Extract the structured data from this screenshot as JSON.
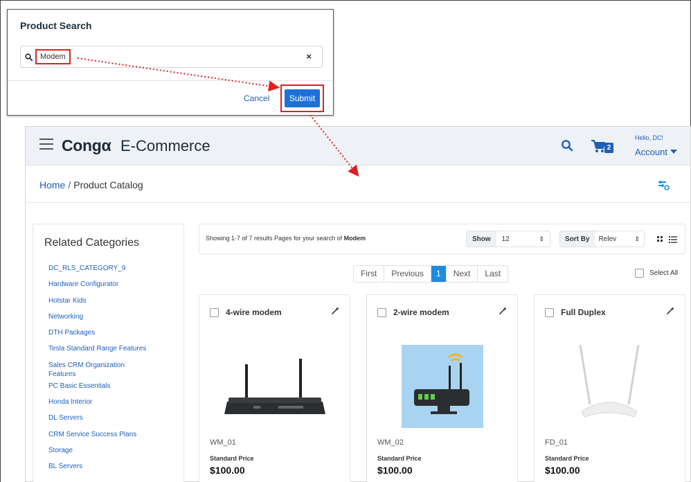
{
  "search_dialog": {
    "title": "Product Search",
    "query": "Modem",
    "clear_symbol": "×",
    "cancel_label": "Cancel",
    "submit_label": "Submit",
    "highlight_color": "#e02020"
  },
  "header": {
    "brand": "Congα",
    "brand_sub": "E-Commerce",
    "cart_count": "2",
    "greeting": "Hello, DC!",
    "account_label": "Account",
    "icons": [
      "hamburger-icon",
      "search-icon",
      "cart-icon",
      "chevron-down-icon"
    ]
  },
  "breadcrumb": {
    "home": "Home",
    "separator": "/",
    "current": "Product Catalog"
  },
  "sidebar": {
    "title": "Related Categories",
    "categories": [
      "DC_RLS_CATEGORY_9",
      "Hardware Configurator",
      "Hotstar Kids",
      "Networking",
      "DTH Packages",
      "Tesla Standard Range Features",
      "Sales CRM Organization Features",
      "PC Basic Essentials",
      "Honda Interior",
      "DL Servers",
      "CRM Service Success Plans",
      "Storage",
      "BL Servers"
    ]
  },
  "results": {
    "showing_prefix": "Showing 1-7 of 7 results Pages for your search of",
    "search_term": "Modem",
    "show_label": "Show",
    "show_value": "12",
    "sort_label": "Sort By",
    "sort_value": "Relev",
    "select_all": "Select All"
  },
  "pagination": {
    "first": "First",
    "previous": "Previous",
    "current": "1",
    "next": "Next",
    "last": "Last"
  },
  "products": [
    {
      "name": "4-wire modem",
      "code": "WM_01",
      "price_label": "Standard Price",
      "price": "$100.00"
    },
    {
      "name": "2-wire modem",
      "code": "WM_02",
      "price_label": "Standard Price",
      "price": "$100.00"
    },
    {
      "name": "Full Duplex",
      "code": "FD_01",
      "price_label": "Standard Price",
      "price": "$100.00"
    }
  ],
  "colors": {
    "brand_blue": "#1f5fb8",
    "active_page": "#1f8ae0",
    "annotation_red": "#e02020"
  }
}
